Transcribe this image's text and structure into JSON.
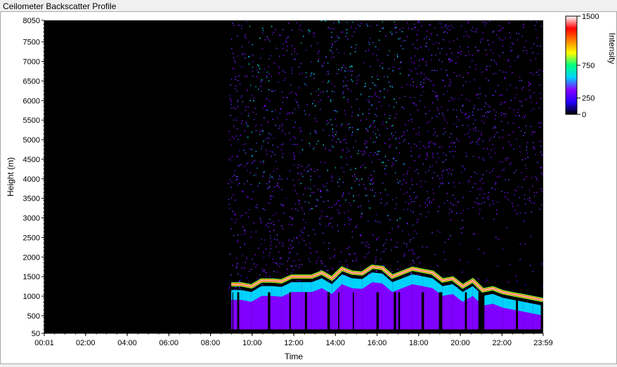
{
  "window": {
    "title": "Ceilometer Backscatter Profile"
  },
  "chart_data": {
    "type": "heatmap",
    "title": "",
    "xlabel": "Time",
    "ylabel": "Height (m)",
    "x_ticks": [
      "00:01",
      "02:00",
      "04:00",
      "06:00",
      "08:00",
      "10:00",
      "12:00",
      "14:00",
      "16:00",
      "18:00",
      "20:00",
      "22:00",
      "23:59"
    ],
    "x_range_minutes": [
      1,
      1439
    ],
    "y_ticks": [
      50,
      500,
      1000,
      1500,
      2000,
      2500,
      3000,
      3500,
      4000,
      4500,
      5000,
      5500,
      6000,
      6500,
      7000,
      7500,
      8050
    ],
    "ylim": [
      50,
      8050
    ],
    "no_data_until": "08:50",
    "background": "#000000",
    "colorbar": {
      "label": "Intensity",
      "ticks": [
        0,
        250,
        750,
        1500
      ],
      "range": [
        0,
        1500
      ],
      "colors": [
        "#000000",
        "#2200ff",
        "#8800ff",
        "#00d0ff",
        "#00ff80",
        "#ffff00",
        "#ff8000",
        "#ff0000",
        "#ffffff"
      ]
    },
    "cloud_base_layer": {
      "start": "09:00",
      "end": "23:59",
      "heights_m": [
        1300,
        1300,
        1250,
        1400,
        1400,
        1380,
        1500,
        1500,
        1500,
        1600,
        1450,
        1700,
        1600,
        1580,
        1750,
        1720,
        1500,
        1600,
        1700,
        1650,
        1600,
        1400,
        1450,
        1250,
        1400,
        1150,
        1200,
        1100,
        1050,
        1000,
        950,
        900
      ],
      "peak_intensity": 1500
    },
    "series": [
      {
        "name": "",
        "description_points": [
          {
            "time": "10:30",
            "height_m": 8050,
            "intensity": 400
          },
          {
            "time": "13:30",
            "height_m": 8050,
            "intensity": 400
          },
          {
            "time": "16:00",
            "height_m": 6000,
            "intensity": 200
          },
          {
            "time": "20:00",
            "height_m": 6000,
            "intensity": 100
          }
        ]
      }
    ]
  }
}
